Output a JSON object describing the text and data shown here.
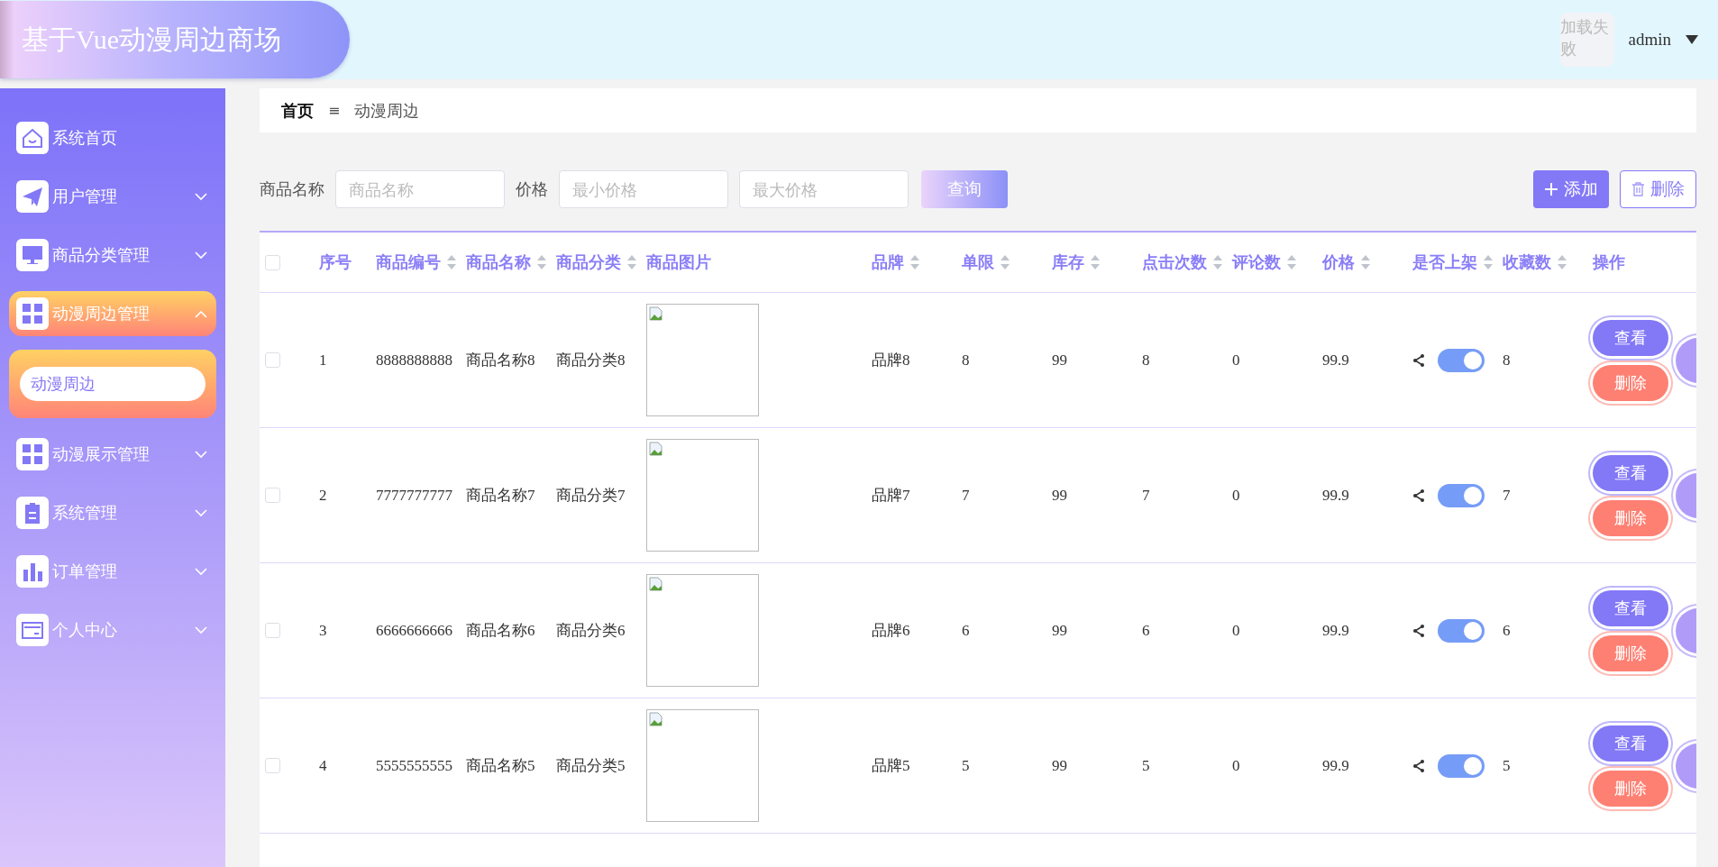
{
  "header": {
    "title": "基于Vue动漫周边商场",
    "avatar_alt": "加载失败",
    "user": "admin"
  },
  "sidebar": {
    "items": [
      {
        "label": "系统首页",
        "selected": false
      },
      {
        "label": "用户管理",
        "selected": false,
        "expanded": false
      },
      {
        "label": "商品分类管理",
        "selected": false,
        "expanded": false
      },
      {
        "label": "动漫周边管理",
        "selected": true,
        "expanded": true,
        "children": [
          {
            "label": "动漫周边",
            "selected": true
          }
        ]
      },
      {
        "label": "动漫展示管理",
        "selected": false,
        "expanded": false
      },
      {
        "label": "系统管理",
        "selected": false,
        "expanded": false
      },
      {
        "label": "订单管理",
        "selected": false,
        "expanded": false
      },
      {
        "label": "个人中心",
        "selected": false,
        "expanded": false
      }
    ]
  },
  "breadcrumb": {
    "items": [
      "首页",
      "动漫周边"
    ],
    "separator": "≡"
  },
  "search": {
    "fields": [
      {
        "label": "商品名称",
        "placeholder": "商品名称"
      },
      {
        "label": "价格",
        "placeholder": "最小价格"
      },
      {
        "placeholder": "最大价格"
      }
    ],
    "button": "查询"
  },
  "actions": {
    "add": "添加",
    "delete": "删除"
  },
  "table": {
    "header_checked": false,
    "columns": [
      {
        "label": "序号",
        "sortable": false
      },
      {
        "label": "商品编号",
        "sortable": true
      },
      {
        "label": "商品名称",
        "sortable": true
      },
      {
        "label": "商品分类",
        "sortable": true
      },
      {
        "label": "商品图片",
        "sortable": false
      },
      {
        "label": "品牌",
        "sortable": true
      },
      {
        "label": "单限",
        "sortable": true
      },
      {
        "label": "库存",
        "sortable": true
      },
      {
        "label": "点击次数",
        "sortable": true
      },
      {
        "label": "评论数",
        "sortable": true
      },
      {
        "label": "价格",
        "sortable": true
      },
      {
        "label": "是否上架",
        "sortable": true
      },
      {
        "label": "收藏数",
        "sortable": true
      },
      {
        "label": "操作",
        "sortable": false
      }
    ],
    "rows": [
      {
        "checked": false,
        "index": "1",
        "code": "8888888888",
        "name": "商品名称8",
        "category": "商品分类8",
        "brand": "品牌8",
        "limit": "8",
        "stock": "99",
        "clicks": "8",
        "comments": "0",
        "price": "99.9",
        "on_sale": true,
        "favorites": "8",
        "actions": [
          "查看",
          "删除"
        ]
      },
      {
        "checked": false,
        "index": "2",
        "code": "7777777777",
        "name": "商品名称7",
        "category": "商品分类7",
        "brand": "品牌7",
        "limit": "7",
        "stock": "99",
        "clicks": "7",
        "comments": "0",
        "price": "99.9",
        "on_sale": true,
        "favorites": "7",
        "actions": [
          "查看",
          "删除"
        ]
      },
      {
        "checked": false,
        "index": "3",
        "code": "6666666666",
        "name": "商品名称6",
        "category": "商品分类6",
        "brand": "品牌6",
        "limit": "6",
        "stock": "99",
        "clicks": "6",
        "comments": "0",
        "price": "99.9",
        "on_sale": true,
        "favorites": "6",
        "actions": [
          "查看",
          "删除"
        ]
      },
      {
        "checked": false,
        "index": "4",
        "code": "5555555555",
        "name": "商品名称5",
        "category": "商品分类5",
        "brand": "品牌5",
        "limit": "5",
        "stock": "99",
        "clicks": "5",
        "comments": "0",
        "price": "99.9",
        "on_sale": true,
        "favorites": "5",
        "actions": [
          "查看",
          "删除"
        ]
      }
    ]
  }
}
